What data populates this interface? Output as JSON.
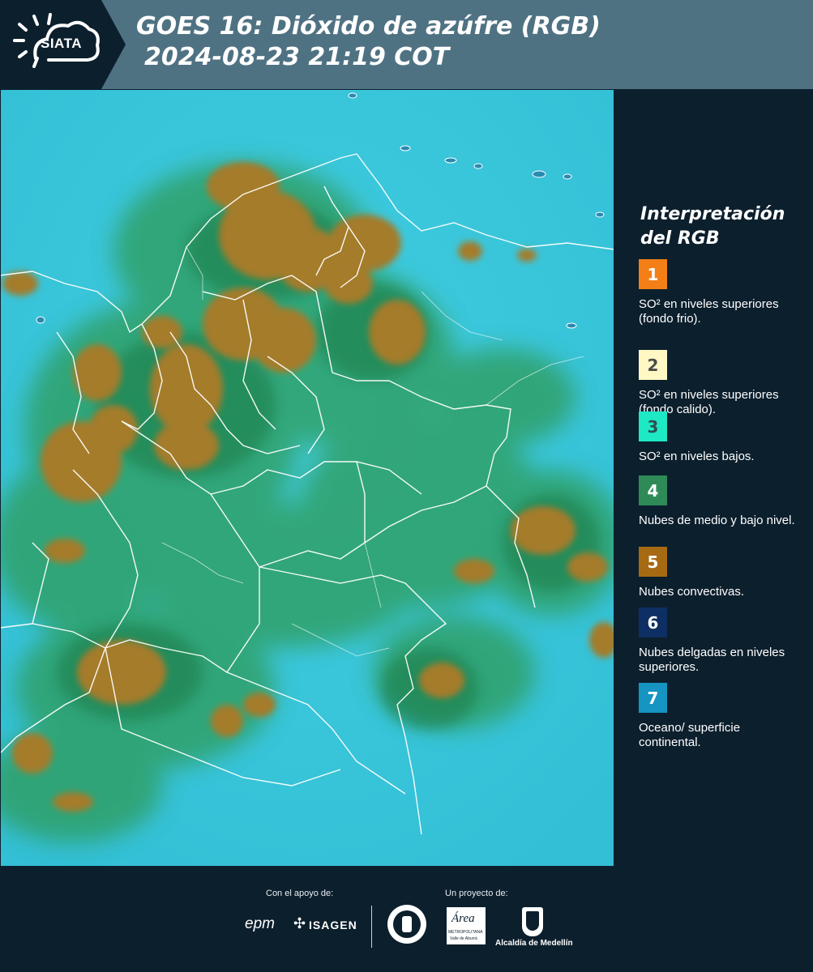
{
  "header": {
    "logo_text": "SIATA",
    "title_line1": "GOES 16: Dióxido de azúfre (RGB)",
    "title_line2": "2024-08-23 21:19 COT"
  },
  "legend": {
    "title_line1": "Interpretación",
    "title_line2": "del RGB",
    "items": [
      {
        "number": "1",
        "color": "#f57f17",
        "text_color": "#ffffff",
        "description": "SO² en niveles superiores (fondo frio)."
      },
      {
        "number": "2",
        "color": "#fff8c4",
        "text_color": "#4b4b4b",
        "description": "SO² en niveles superiores (fondo calido)."
      },
      {
        "number": "3",
        "color": "#1de9c5",
        "text_color": "#2c4f52",
        "description": "SO² en niveles bajos."
      },
      {
        "number": "4",
        "color": "#2e8b57",
        "text_color": "#ffffff",
        "description": "Nubes de medio y bajo nivel."
      },
      {
        "number": "5",
        "color": "#a66a12",
        "text_color": "#ffffff",
        "description": "Nubes convectivas."
      },
      {
        "number": "6",
        "color": "#0d2f63",
        "text_color": "#ffffff",
        "description": "Nubes delgadas en niveles superiores."
      },
      {
        "number": "7",
        "color": "#1695c2",
        "text_color": "#ffffff",
        "description": "Oceano/ superficie continental."
      }
    ]
  },
  "footer": {
    "support_label": "Con el apoyo de:",
    "project_label": "Un proyecto de:",
    "sponsor_epm": "epm",
    "sponsor_isagen": "ISAGEN",
    "sponsor_area": "Área",
    "sponsor_area_sub": "METROPOLITANA",
    "sponsor_area_sub2": "Valle de Aburrá",
    "sponsor_alcaldia": "Alcaldía de Medellín"
  },
  "colors": {
    "background": "#0c1f2d",
    "header": "#4f7283",
    "ocean": "#3ac7db",
    "convective": "#a0792a",
    "low_cloud": "#2f9b5a"
  }
}
